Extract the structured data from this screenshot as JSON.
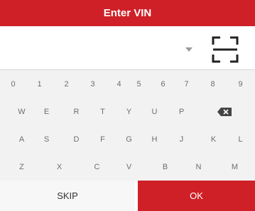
{
  "dialog": {
    "title": "Enter VIN"
  },
  "vin_input": {
    "value": "",
    "dropdown_icon": "dropdown-arrow-icon",
    "scan_icon": "scan-frame-icon"
  },
  "keyboard": {
    "rows": [
      [
        "0",
        "1",
        "2",
        "3",
        "4",
        "5",
        "6",
        "7",
        "8",
        "9"
      ],
      [
        "W",
        "E",
        "R",
        "T",
        "Y",
        "U",
        "P"
      ],
      [
        "A",
        "S",
        "D",
        "F",
        "G",
        "H",
        "J",
        "K",
        "L"
      ],
      [
        "Z",
        "X",
        "C",
        "V",
        "B",
        "N",
        "M"
      ]
    ],
    "backspace_icon": "backspace-icon"
  },
  "buttons": {
    "skip_label": "SKIP",
    "ok_label": "OK"
  },
  "colors": {
    "accent": "#cf2027",
    "keyboard_bg": "#f2f2f2",
    "key_text": "#6e6e6e"
  }
}
